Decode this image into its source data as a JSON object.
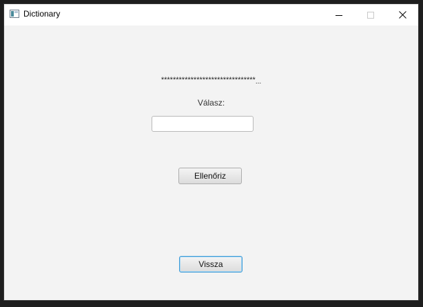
{
  "window": {
    "title": "Dictionary",
    "app_icon": "app-window-icon",
    "controls": {
      "minimize_icon": "minimize-icon",
      "maximize_icon": "maximize-icon",
      "close_icon": "close-icon"
    }
  },
  "quiz": {
    "masked_word": "********************************",
    "masked_overflow": "...",
    "answer_label": "Válasz:",
    "answer_value": "",
    "check_button": "Ellenőriz",
    "back_button": "Vissza"
  },
  "colors": {
    "background": "#f3f3f3",
    "focus_accent": "#3c9ad6"
  }
}
